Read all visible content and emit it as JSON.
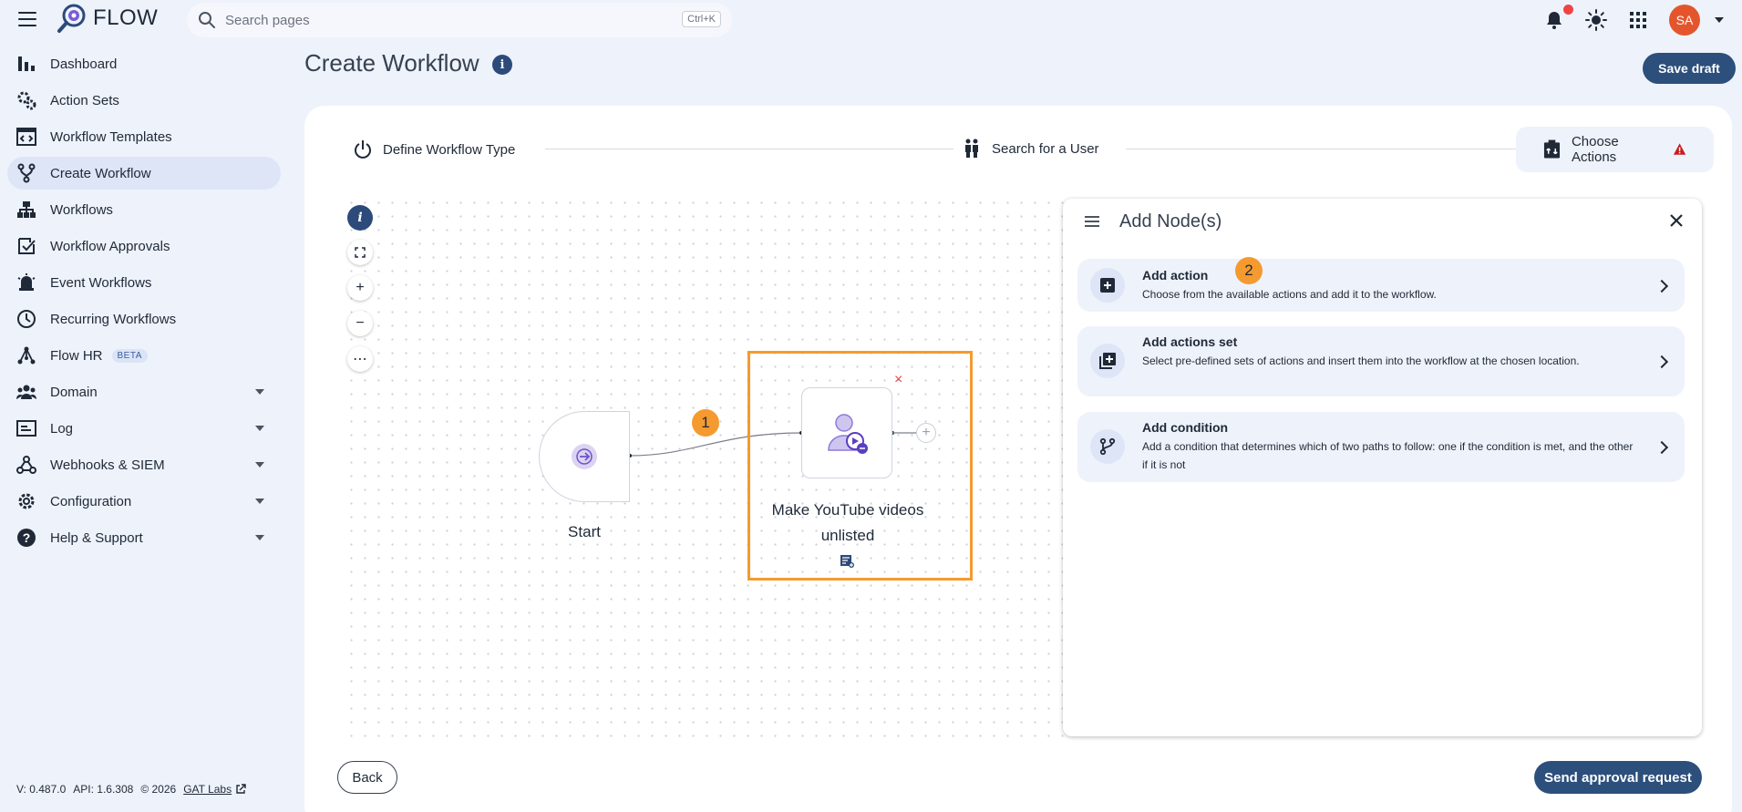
{
  "app": {
    "name": "FLOW",
    "search_placeholder": "Search pages",
    "search_shortcut": "Ctrl+K",
    "avatar_initials": "SA",
    "accent_color": "#2c4f7c",
    "highlight_color": "#f59a2e"
  },
  "sidebar": {
    "items": [
      {
        "label": "Dashboard",
        "icon": "bar-chart-icon"
      },
      {
        "label": "Action Sets",
        "icon": "gears-icon"
      },
      {
        "label": "Workflow Templates",
        "icon": "template-icon"
      },
      {
        "label": "Create Workflow",
        "icon": "branch-icon",
        "active": true
      },
      {
        "label": "Workflows",
        "icon": "hierarchy-icon"
      },
      {
        "label": "Workflow Approvals",
        "icon": "approval-icon"
      },
      {
        "label": "Event Workflows",
        "icon": "alarm-icon"
      },
      {
        "label": "Recurring Workflows",
        "icon": "clock-icon"
      },
      {
        "label": "Flow HR",
        "icon": "network-icon",
        "badge": "BETA"
      },
      {
        "label": "Domain",
        "icon": "people-icon",
        "expandable": true
      },
      {
        "label": "Log",
        "icon": "log-icon",
        "expandable": true
      },
      {
        "label": "Webhooks & SIEM",
        "icon": "webhook-icon",
        "expandable": true
      },
      {
        "label": "Configuration",
        "icon": "gear-icon",
        "expandable": true
      },
      {
        "label": "Help & Support",
        "icon": "help-icon",
        "expandable": true
      }
    ],
    "footer": {
      "version": "V: 0.487.0",
      "api": "API: 1.6.308",
      "copyright": "© 2026",
      "company_link": "GAT Labs"
    }
  },
  "header": {
    "title": "Create Workflow",
    "info_label": "i",
    "save_draft": "Save draft"
  },
  "stepper": {
    "steps": [
      {
        "label": "Define Workflow Type",
        "icon": "power-icon"
      },
      {
        "label": "Search for a User",
        "icon": "users-icon"
      },
      {
        "label": "Choose Actions",
        "icon": "actions-icon",
        "warning": true
      }
    ]
  },
  "canvas": {
    "controls": {
      "info": "i",
      "zoom_in": "+",
      "zoom_out": "−",
      "more": "⋯"
    },
    "start_label": "Start",
    "action_label": "Make YouTube videos unlisted",
    "delete_symbol": "×",
    "add_symbol": "+",
    "badge_1": "1",
    "badge_2": "2"
  },
  "panel": {
    "title": "Add Node(s)",
    "options": [
      {
        "title": "Add action",
        "desc": "Choose from the available actions and add it to the workflow.",
        "icon": "add-box-icon"
      },
      {
        "title": "Add actions set",
        "desc": "Select pre-defined sets of actions and insert them into the workflow at the chosen location.",
        "icon": "add-library-icon"
      },
      {
        "title": "Add condition",
        "desc": "Add a condition that determines which of two paths to follow: one if the condition is met, and the other if it is not",
        "icon": "fork-icon"
      }
    ]
  },
  "footer": {
    "back": "Back",
    "send": "Send approval request"
  }
}
